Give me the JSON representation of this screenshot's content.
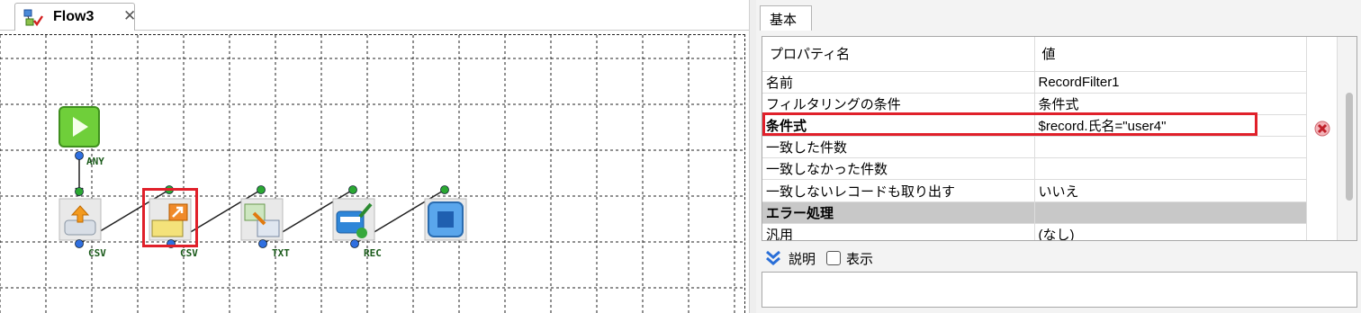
{
  "editor": {
    "tab_title": "Flow3",
    "tab_close": "✕",
    "ports": [
      "ANY",
      "CSV",
      "CSV",
      "TXT",
      "REC"
    ]
  },
  "properties": {
    "tab": "基本",
    "header": {
      "name": "プロパティ名",
      "value": "値"
    },
    "rows": [
      {
        "name": "名前",
        "value": "RecordFilter1",
        "kind": "normal"
      },
      {
        "name": "フィルタリングの条件",
        "value": "条件式",
        "kind": "normal"
      },
      {
        "name": "条件式",
        "value": "$record.氏名=\"user4\"",
        "kind": "bold"
      },
      {
        "name": "一致した件数",
        "value": "",
        "kind": "normal"
      },
      {
        "name": "一致しなかった件数",
        "value": "",
        "kind": "normal"
      },
      {
        "name": "一致しないレコードも取り出す",
        "value": "いいえ",
        "kind": "normal"
      },
      {
        "name": "エラー処理",
        "value": "",
        "kind": "section"
      },
      {
        "name": "汎用",
        "value": "(なし)",
        "kind": "normal"
      }
    ],
    "description": {
      "label": "説明",
      "checkbox_label": "表示",
      "checked": false
    }
  },
  "colors": {
    "highlight": "#e0202a",
    "section_bg": "#c8c8c8",
    "port_blue": "#2f6fe0",
    "port_green": "#2aa832"
  }
}
